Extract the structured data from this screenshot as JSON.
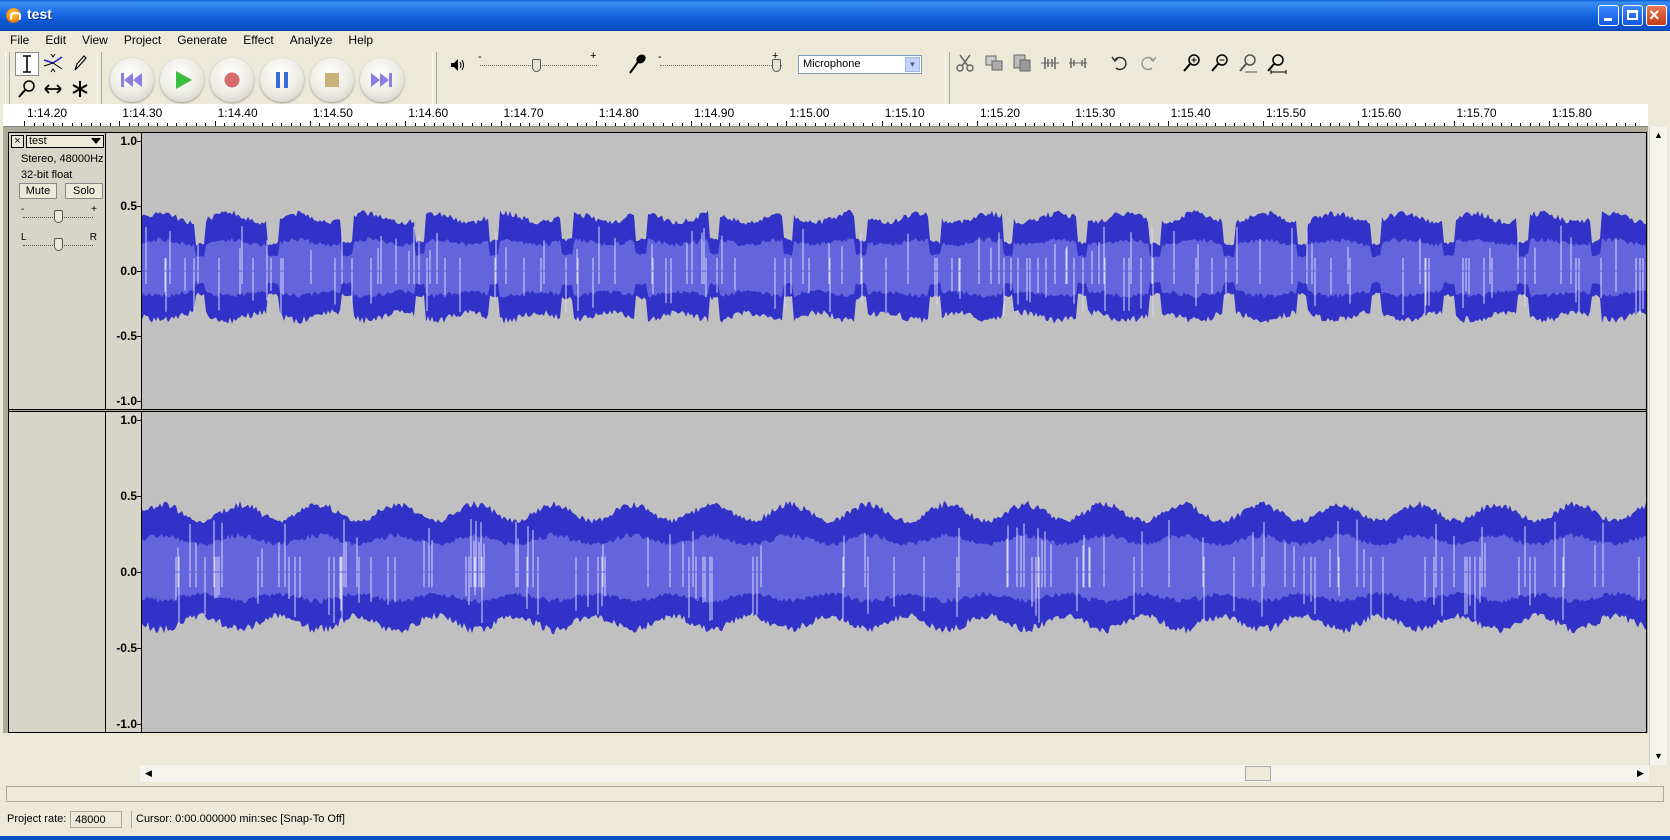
{
  "window": {
    "title": "test"
  },
  "menu": [
    "File",
    "Edit",
    "View",
    "Project",
    "Generate",
    "Effect",
    "Analyze",
    "Help"
  ],
  "toolbar": {
    "playback_level_minus": "-",
    "playback_level_plus": "+",
    "record_level_minus": "-",
    "record_level_plus": "+",
    "input_source": "Microphone"
  },
  "ruler": {
    "labels": [
      "1:14.20",
      "1:14.30",
      "1:14.40",
      "1:14.50",
      "1:14.60",
      "1:14.70",
      "1:14.80",
      "1:14.90",
      "1:15.00",
      "1:15.10",
      "1:15.20",
      "1:15.30",
      "1:15.40",
      "1:15.50",
      "1:15.60",
      "1:15.70",
      "1:15.80"
    ]
  },
  "track": {
    "name": "test",
    "format": "Stereo, 48000Hz",
    "bit_depth": "32-bit float",
    "mute_label": "Mute",
    "solo_label": "Solo",
    "gain_minus": "-",
    "gain_plus": "+",
    "pan_left": "L",
    "pan_right": "R",
    "amplitude_labels": [
      "1.0",
      "0.5",
      "0.0",
      "-0.5",
      "-1.0"
    ]
  },
  "colors": {
    "wave_dark": "#3232c8",
    "wave_light": "#6464dc",
    "wave_background": "#c0c0c0"
  },
  "status": {
    "project_rate_label": "Project rate:",
    "project_rate_value": "48000",
    "cursor_text": "Cursor: 0:00.000000 min:sec  [Snap-To Off]"
  }
}
